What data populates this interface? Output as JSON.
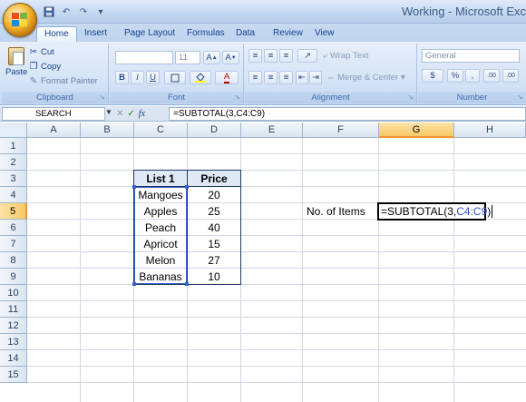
{
  "window": {
    "title": "Working - Microsoft Exc"
  },
  "quick_access": {
    "icons": [
      "save-icon",
      "undo-icon",
      "redo-icon",
      "customize-icon"
    ]
  },
  "tabs": [
    {
      "label": "Home",
      "active": true
    },
    {
      "label": "Insert"
    },
    {
      "label": "Page Layout"
    },
    {
      "label": "Formulas"
    },
    {
      "label": "Data"
    },
    {
      "label": "Review"
    },
    {
      "label": "View"
    }
  ],
  "ribbon": {
    "clipboard": {
      "label": "Clipboard",
      "paste": "Paste",
      "cut": "Cut",
      "copy": "Copy",
      "format_painter": "Format Painter"
    },
    "font": {
      "label": "Font",
      "font_size": "11",
      "bold": "B",
      "italic": "I",
      "underline": "U",
      "grow": "A",
      "shrink": "A",
      "font_color": "A"
    },
    "alignment": {
      "label": "Alignment",
      "wrap_text": "Wrap Text",
      "merge_center": "Merge & Center"
    },
    "number": {
      "label": "Number",
      "format": "General",
      "currency": "$",
      "percent": "%",
      "comma": ",",
      "inc_decimal": ".00",
      "dec_decimal": ".00"
    }
  },
  "formula_bar": {
    "name_box": "SEARCH",
    "cancel": "✕",
    "enter": "✓",
    "fx": "fx",
    "formula": "=SUBTOTAL(3,C4:C9)"
  },
  "columns": [
    "A",
    "B",
    "C",
    "D",
    "E",
    "F",
    "G",
    "H"
  ],
  "rows": [
    "1",
    "2",
    "3",
    "4",
    "5",
    "6",
    "7",
    "8",
    "9",
    "10",
    "11",
    "12",
    "13",
    "14",
    "15"
  ],
  "table": {
    "headers": [
      "List 1",
      "Price"
    ],
    "rows": [
      [
        "Mangoes",
        "20"
      ],
      [
        "Apples",
        "25"
      ],
      [
        "Peach",
        "40"
      ],
      [
        "Apricot",
        "15"
      ],
      [
        "Melon",
        "27"
      ],
      [
        "Bananas",
        "10"
      ]
    ]
  },
  "label_cell": "No. of Items",
  "editing_cell": {
    "prefix": "=SUBTOTAL(3,",
    "ref": "C4:C9",
    "suffix": ")"
  },
  "colors": {
    "ribbon": "#d6e4f6",
    "selected_header": "#f8c866",
    "table_border": "#1f3864",
    "ref_blue": "#2c53c6"
  }
}
